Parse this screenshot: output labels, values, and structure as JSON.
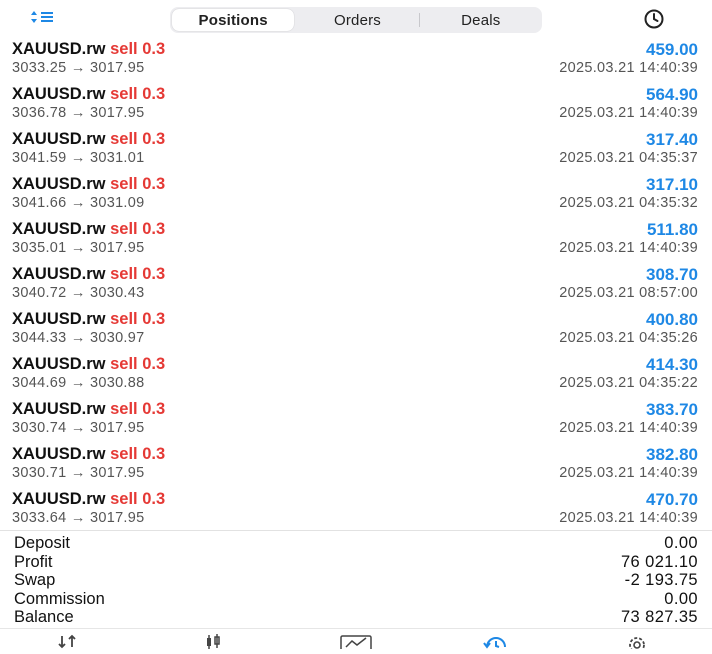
{
  "header": {
    "tabs": [
      {
        "label": "Positions",
        "active": true
      },
      {
        "label": "Orders",
        "active": false
      },
      {
        "label": "Deals",
        "active": false
      }
    ],
    "sort_icon": "sort-icon",
    "history_icon": "clock-icon"
  },
  "colors": {
    "accent": "#1e88e5",
    "sell": "#e53935"
  },
  "positions": [
    {
      "symbol": "XAUUSD.rw",
      "side": "sell 0.3",
      "prices": "3033.25 → 3017.95",
      "profit": "459.00",
      "time": "2025.03.21 14:40:39"
    },
    {
      "symbol": "XAUUSD.rw",
      "side": "sell 0.3",
      "prices": "3036.78 → 3017.95",
      "profit": "564.90",
      "time": "2025.03.21 14:40:39"
    },
    {
      "symbol": "XAUUSD.rw",
      "side": "sell 0.3",
      "prices": "3041.59 → 3031.01",
      "profit": "317.40",
      "time": "2025.03.21 04:35:37"
    },
    {
      "symbol": "XAUUSD.rw",
      "side": "sell 0.3",
      "prices": "3041.66 → 3031.09",
      "profit": "317.10",
      "time": "2025.03.21 04:35:32"
    },
    {
      "symbol": "XAUUSD.rw",
      "side": "sell 0.3",
      "prices": "3035.01 → 3017.95",
      "profit": "511.80",
      "time": "2025.03.21 14:40:39"
    },
    {
      "symbol": "XAUUSD.rw",
      "side": "sell 0.3",
      "prices": "3040.72 → 3030.43",
      "profit": "308.70",
      "time": "2025.03.21 08:57:00"
    },
    {
      "symbol": "XAUUSD.rw",
      "side": "sell 0.3",
      "prices": "3044.33 → 3030.97",
      "profit": "400.80",
      "time": "2025.03.21 04:35:26"
    },
    {
      "symbol": "XAUUSD.rw",
      "side": "sell 0.3",
      "prices": "3044.69 → 3030.88",
      "profit": "414.30",
      "time": "2025.03.21 04:35:22"
    },
    {
      "symbol": "XAUUSD.rw",
      "side": "sell 0.3",
      "prices": "3030.74 → 3017.95",
      "profit": "383.70",
      "time": "2025.03.21 14:40:39"
    },
    {
      "symbol": "XAUUSD.rw",
      "side": "sell 0.3",
      "prices": "3030.71 → 3017.95",
      "profit": "382.80",
      "time": "2025.03.21 14:40:39"
    },
    {
      "symbol": "XAUUSD.rw",
      "side": "sell 0.3",
      "prices": "3033.64 → 3017.95",
      "profit": "470.70",
      "time": "2025.03.21 14:40:39"
    }
  ],
  "summary": [
    {
      "label": "Deposit",
      "value": "0.00"
    },
    {
      "label": "Profit",
      "value": "76 021.10"
    },
    {
      "label": "Swap",
      "value": "-2 193.75"
    },
    {
      "label": "Commission",
      "value": "0.00"
    },
    {
      "label": "Balance",
      "value": "73 827.35"
    }
  ],
  "nav": [
    {
      "icon": "quotes-icon",
      "active": false
    },
    {
      "icon": "chart-candles-icon",
      "active": false
    },
    {
      "icon": "trade-chart-icon",
      "active": false
    },
    {
      "icon": "history-icon",
      "active": true
    },
    {
      "icon": "settings-gear-icon",
      "active": false
    }
  ]
}
